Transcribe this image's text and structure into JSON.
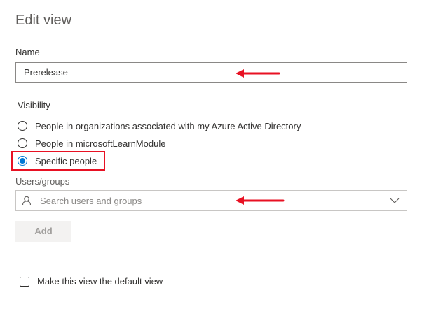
{
  "header": {
    "title": "Edit view"
  },
  "name_field": {
    "label": "Name",
    "value": "Prerelease"
  },
  "visibility": {
    "label": "Visibility",
    "options": [
      {
        "label": "People in organizations associated with my Azure Active Directory",
        "selected": false
      },
      {
        "label": "People in microsoftLearnModule",
        "selected": false
      },
      {
        "label": "Specific people",
        "selected": true
      }
    ]
  },
  "users_groups": {
    "label": "Users/groups",
    "placeholder": "Search users and groups",
    "icon": "person-icon",
    "dropdown_icon": "chevron-down-icon"
  },
  "actions": {
    "add_label": "Add",
    "add_enabled": false
  },
  "default_view": {
    "label": "Make this view the default view",
    "checked": false
  },
  "annotations": {
    "highlight_color": "#e81123",
    "arrow_color": "#e81123"
  },
  "colors": {
    "accent": "#0078d4",
    "text": "#323130",
    "muted": "#8a8886"
  }
}
